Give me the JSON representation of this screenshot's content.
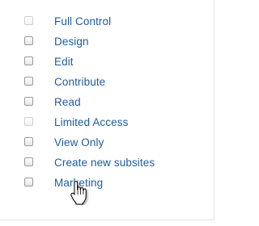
{
  "permissions": [
    {
      "label": "Full Control",
      "enabled": false
    },
    {
      "label": "Design",
      "enabled": true
    },
    {
      "label": "Edit",
      "enabled": true
    },
    {
      "label": "Contribute",
      "enabled": true
    },
    {
      "label": "Read",
      "enabled": true
    },
    {
      "label": "Limited Access",
      "enabled": false
    },
    {
      "label": "View Only",
      "enabled": true
    },
    {
      "label": "Create new subsites",
      "enabled": true
    },
    {
      "label": "Marketing",
      "enabled": true
    }
  ],
  "cursor": {
    "icon": "hand-pointer-icon"
  },
  "colors": {
    "link": "#1f5c99",
    "checkbox_border": "#9a9a9a",
    "checkbox_disabled_border": "#cfcfcf"
  }
}
